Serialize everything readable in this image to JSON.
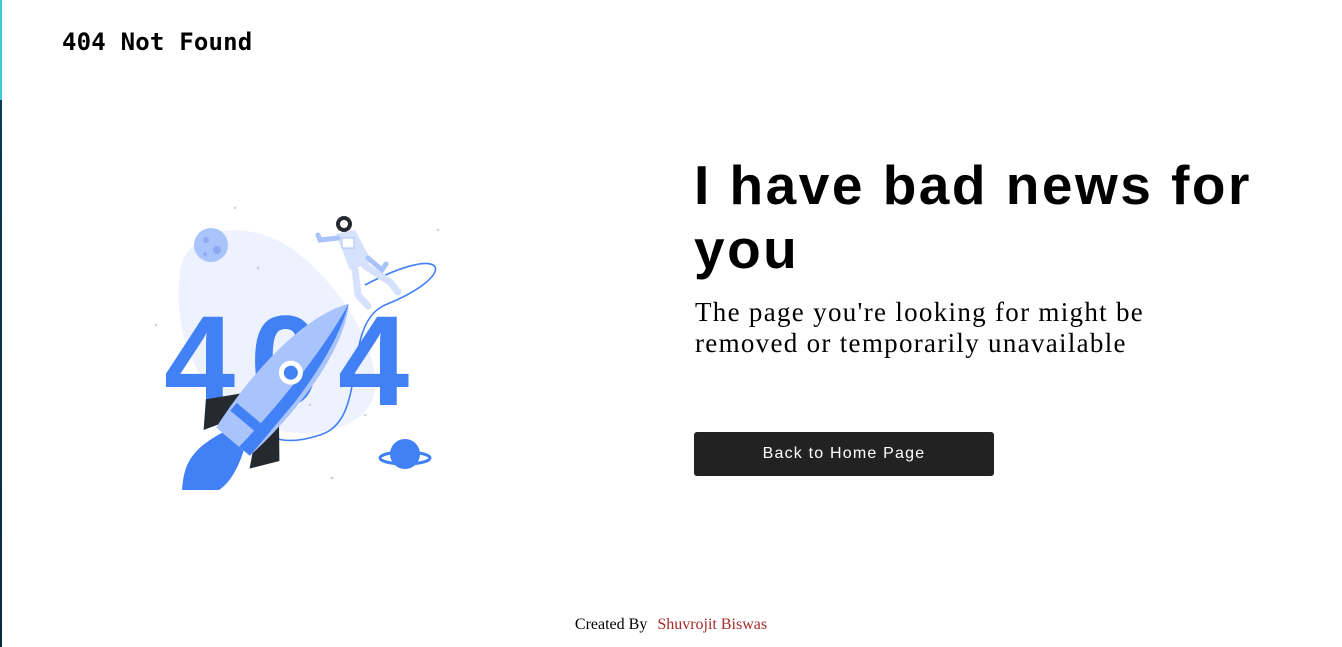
{
  "header": {
    "brand": "404 Not Found"
  },
  "illustration": {
    "text": "404",
    "icon": "rocket-astronaut-404-illustration",
    "colors": {
      "primary": "#4180f5",
      "light": "#a9c3fb",
      "blob": "#edf2fe",
      "dark": "#252a31"
    }
  },
  "main": {
    "headline": "I have bad news for you",
    "message": "The page you're looking for might be removed or temporarily unavailable",
    "button_label": "Back to Home Page",
    "button_color": "#222222"
  },
  "footer": {
    "prefix": "Created By",
    "author": "Shuvrojit Biswas",
    "author_color": "#a52a2a"
  }
}
